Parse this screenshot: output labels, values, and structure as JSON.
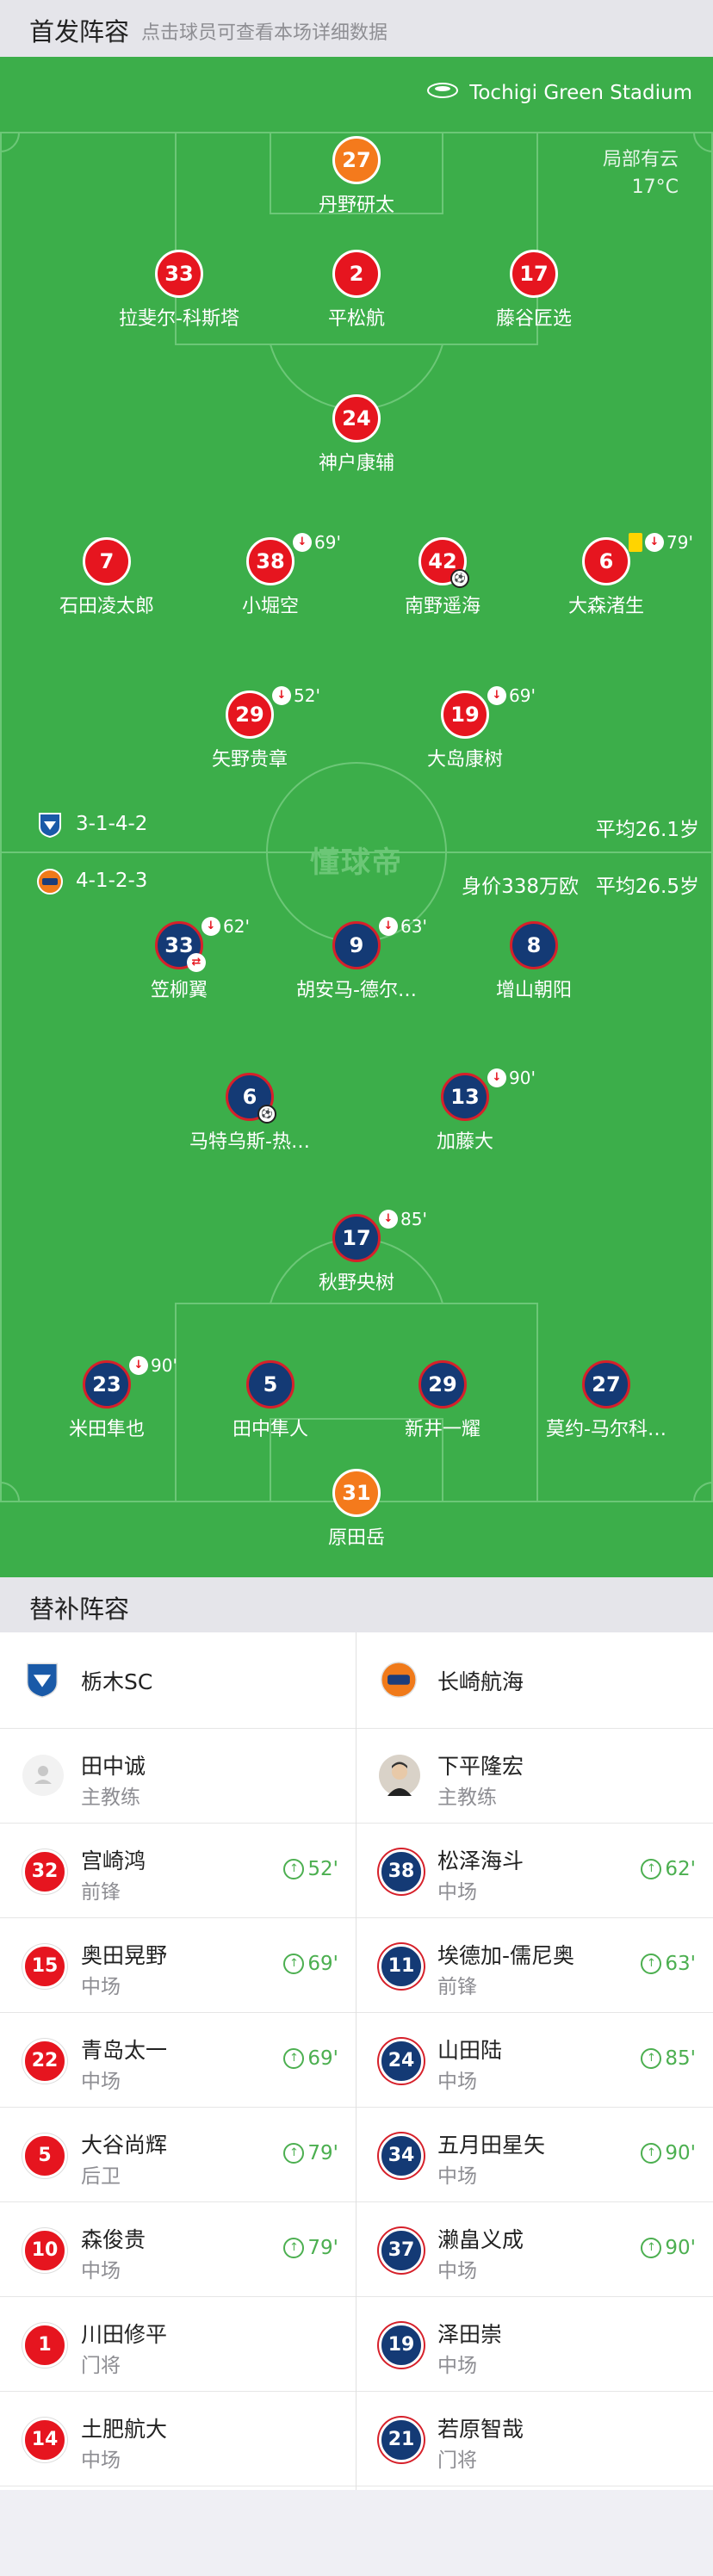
{
  "header": {
    "title": "首发阵容",
    "subtitle": "点击球员可查看本场详细数据"
  },
  "venue": {
    "stadium": "Tochigi Green Stadium",
    "weather": "局部有云",
    "temperature": "17°C"
  },
  "watermark": "懂球帝",
  "home": {
    "formation": "3-1-4-2",
    "avg_age": "平均26.1岁",
    "players": [
      {
        "num": "27",
        "name": "丹野研太",
        "color": "orange"
      },
      {
        "num": "33",
        "name": "拉斐尔-科斯塔",
        "color": "red"
      },
      {
        "num": "2",
        "name": "平松航",
        "color": "red"
      },
      {
        "num": "17",
        "name": "藤谷匠选",
        "color": "red"
      },
      {
        "num": "24",
        "name": "神户康辅",
        "color": "red"
      },
      {
        "num": "7",
        "name": "石田凌太郎",
        "color": "red"
      },
      {
        "num": "38",
        "name": "小堀空",
        "color": "red",
        "sub_out": "69'"
      },
      {
        "num": "42",
        "name": "南野遥海",
        "color": "red",
        "goal": true
      },
      {
        "num": "6",
        "name": "大森渚生",
        "color": "red",
        "yellow": true,
        "sub_out": "79'"
      },
      {
        "num": "29",
        "name": "矢野贵章",
        "color": "red",
        "sub_out": "52'"
      },
      {
        "num": "19",
        "name": "大岛康树",
        "color": "red",
        "sub_out": "69'"
      }
    ]
  },
  "away": {
    "formation": "4-1-2-3",
    "value": "身价338万欧",
    "avg_age": "平均26.5岁",
    "players": [
      {
        "num": "33",
        "name": "笠柳翼",
        "sub_out": "62'",
        "swap": true
      },
      {
        "num": "9",
        "name": "胡安马-德尔…",
        "sub_out": "63'"
      },
      {
        "num": "8",
        "name": "增山朝阳"
      },
      {
        "num": "6",
        "name": "马特乌斯-热…",
        "goal": true
      },
      {
        "num": "13",
        "name": "加藤大",
        "sub_out": "90'"
      },
      {
        "num": "17",
        "name": "秋野央树",
        "sub_out": "85'"
      },
      {
        "num": "23",
        "name": "米田隼也",
        "sub_out": "90'"
      },
      {
        "num": "5",
        "name": "田中隼人"
      },
      {
        "num": "29",
        "name": "新井一耀"
      },
      {
        "num": "27",
        "name": "莫约-马尔科…"
      },
      {
        "num": "31",
        "name": "原田岳",
        "color": "orange"
      }
    ]
  },
  "subs": {
    "title": "替补阵容",
    "home_team": "栃木SC",
    "away_team": "长崎航海",
    "home_coach": {
      "name": "田中诚",
      "role": "主教练"
    },
    "away_coach": {
      "name": "下平隆宏",
      "role": "主教练"
    },
    "home": [
      {
        "num": "32",
        "name": "宫崎鸿",
        "pos": "前锋",
        "in": "52'"
      },
      {
        "num": "15",
        "name": "奥田晃野",
        "pos": "中场",
        "in": "69'"
      },
      {
        "num": "22",
        "name": "青岛太一",
        "pos": "中场",
        "in": "69'"
      },
      {
        "num": "5",
        "name": "大谷尚辉",
        "pos": "后卫",
        "in": "79'"
      },
      {
        "num": "10",
        "name": "森俊贵",
        "pos": "中场",
        "in": "79'"
      },
      {
        "num": "1",
        "name": "川田修平",
        "pos": "门将"
      },
      {
        "num": "14",
        "name": "土肥航大",
        "pos": "中场"
      }
    ],
    "away": [
      {
        "num": "38",
        "name": "松泽海斗",
        "pos": "中场",
        "in": "62'"
      },
      {
        "num": "11",
        "name": "埃德加-儒尼奥",
        "pos": "前锋",
        "in": "63'"
      },
      {
        "num": "24",
        "name": "山田陆",
        "pos": "中场",
        "in": "85'"
      },
      {
        "num": "34",
        "name": "五月田星矢",
        "pos": "中场",
        "in": "90'"
      },
      {
        "num": "37",
        "name": "濑畠义成",
        "pos": "中场",
        "in": "90'"
      },
      {
        "num": "19",
        "name": "泽田崇",
        "pos": "中场"
      },
      {
        "num": "21",
        "name": "若原智哉",
        "pos": "门将"
      }
    ]
  }
}
